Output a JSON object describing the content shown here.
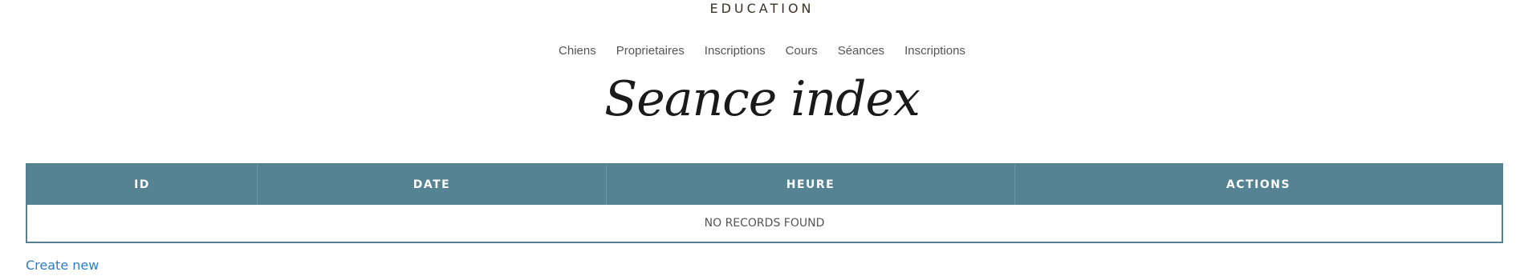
{
  "header": {
    "brand": "EDUCATION"
  },
  "nav": {
    "items": [
      {
        "label": "Chiens"
      },
      {
        "label": "Proprietaires"
      },
      {
        "label": "Inscriptions"
      },
      {
        "label": "Cours"
      },
      {
        "label": "Séances"
      },
      {
        "label": "Inscriptions"
      }
    ]
  },
  "main": {
    "title": "Seance index",
    "table": {
      "columns": [
        "ID",
        "DATE",
        "HEURE",
        "ACTIONS"
      ],
      "empty_message": "NO RECORDS FOUND"
    },
    "create_new_label": "Create new"
  },
  "colors": {
    "table_header_bg": "#558393",
    "table_border": "#54808f",
    "link": "#2a7ec8"
  }
}
